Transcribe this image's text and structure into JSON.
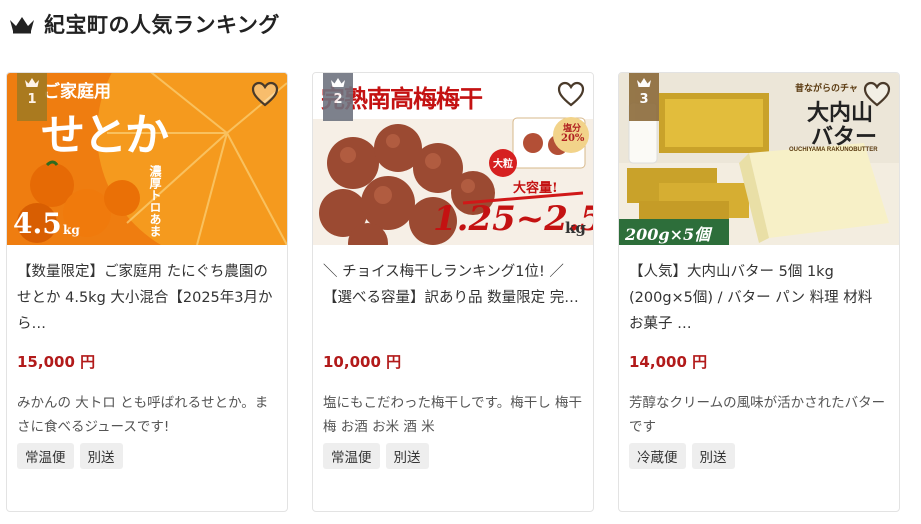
{
  "section": {
    "title": "紀宝町の人気ランキング",
    "crown_icon": "crown-icon"
  },
  "colors": {
    "price": "#b21a1a",
    "tag_bg": "#eeeeee",
    "border": "#e3e3e3"
  },
  "products": [
    {
      "rank": "1",
      "image_text": {
        "main": "せとか",
        "top": "ご家庭用",
        "weight": "4.5",
        "unit": "kg",
        "side": "濃厚トロあま"
      },
      "title": "【数量限定】ご家庭用 たにぐち農園のせとか 4.5kg 大小混合【2025年3月から…",
      "price": "15,000 円",
      "description": "みかんの 大トロ とも呼ばれるせとか。まさに食べるジュースです!",
      "tags": [
        "常温便",
        "別送"
      ]
    },
    {
      "rank": "2",
      "image_text": {
        "main": "完熟南高梅梅干",
        "big": "大粒",
        "capacity": "大容量!",
        "weight_range": "1.25~2.5",
        "unit": "kg",
        "salt_label": "塩分",
        "salt_value": "20%"
      },
      "title": "＼ チョイス梅干しランキング1位! ／【選べる容量】訳あり品 数量限定 完…",
      "price": "10,000 円",
      "description": "塩にもこだわった梅干しです。梅干し 梅干 梅 お酒 お米 酒 米",
      "tags": [
        "常温便",
        "別送"
      ]
    },
    {
      "rank": "3",
      "image_text": {
        "main_line1": "大内山",
        "main_line2": "バター",
        "sub": "昔ながらのチャ",
        "brand": "OUCHIYAMA RAKUNOBUTTER",
        "package": "200g×5個"
      },
      "title": "【人気】大内山バター 5個 1kg (200g×5個) / バター パン 料理 材料 お菓子 …",
      "price": "14,000 円",
      "description": "芳醇なクリームの風味が活かされたバターです",
      "tags": [
        "冷蔵便",
        "別送"
      ]
    }
  ]
}
